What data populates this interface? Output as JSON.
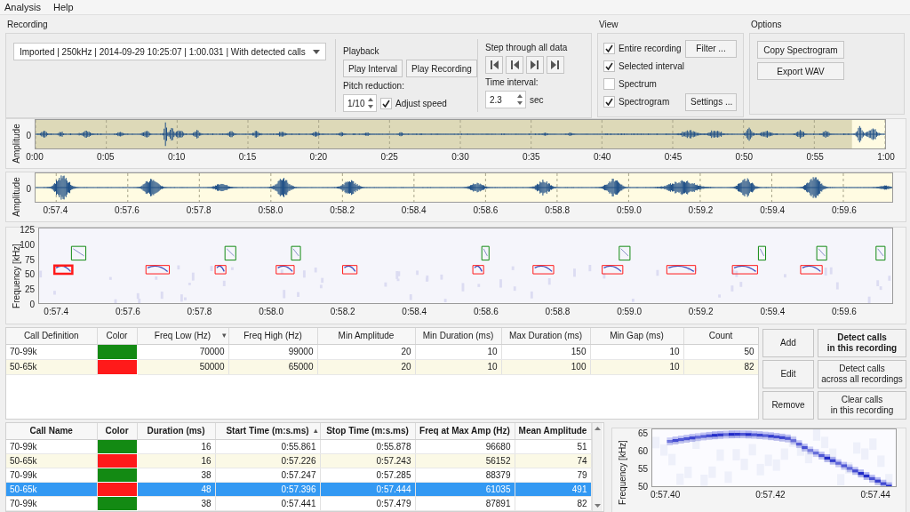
{
  "menu": [
    {
      "label": "Analysis"
    },
    {
      "label": "Help"
    }
  ],
  "recording": {
    "title": "Recording",
    "selector": "Imported | 250kHz | 2014-09-29 10:25:07 | 1:00.031 | With detected calls"
  },
  "playback": {
    "title": "Playback",
    "buttons": [
      "Play Interval",
      "Play Recording"
    ],
    "pitch_label": "Pitch reduction:",
    "pitch_value": "1/10",
    "adjust_speed": {
      "label": "Adjust speed",
      "checked": true
    }
  },
  "step": {
    "title": "Step through all data",
    "interval_label": "Time interval:",
    "interval_value": "2.3",
    "unit": "sec"
  },
  "view": {
    "title": "View",
    "options": [
      {
        "label": "Entire recording",
        "checked": true
      },
      {
        "label": "Selected interval",
        "checked": true
      },
      {
        "label": "Spectrum",
        "checked": false
      },
      {
        "label": "Spectrogram",
        "checked": true
      }
    ],
    "buttons": [
      "Filter ...",
      "Settings ..."
    ]
  },
  "options": {
    "title": "Options",
    "buttons": [
      "Copy Spectrogram",
      "Export WAV"
    ]
  },
  "overview": {
    "ylabel": "Amplitude",
    "ytick": "0",
    "xticks": [
      "0:00",
      "0:05",
      "0:10",
      "0:15",
      "0:20",
      "0:25",
      "0:30",
      "0:35",
      "0:40",
      "0:45",
      "0:50",
      "0:55",
      "1:00"
    ]
  },
  "detail": {
    "ylabel": "Amplitude",
    "ytick": "0",
    "xticks": [
      "0:57.4",
      "0:57.6",
      "0:57.8",
      "0:58.0",
      "0:58.2",
      "0:58.4",
      "0:58.6",
      "0:58.8",
      "0:59.0",
      "0:59.2",
      "0:59.4",
      "0:59.6"
    ]
  },
  "spectrogram": {
    "ylabel": "Frequency [kHz]",
    "yticks": [
      "125",
      "100",
      "75",
      "50",
      "25",
      "0"
    ],
    "xticks": [
      "0:57.4",
      "0:57.6",
      "0:57.8",
      "0:58.0",
      "0:58.2",
      "0:58.4",
      "0:58.6",
      "0:58.8",
      "0:59.0",
      "0:59.2",
      "0:59.4",
      "0:59.6"
    ]
  },
  "definitions": {
    "columns": [
      {
        "label": "Call Definition"
      },
      {
        "label": "Color"
      },
      {
        "label": "Freq Low (Hz)",
        "sort_arrow": "▾"
      },
      {
        "label": "Freq High (Hz)"
      },
      {
        "label": "Min Amplitude"
      },
      {
        "label": "Min Duration (ms)"
      },
      {
        "label": "Max Duration (ms)"
      },
      {
        "label": "Min Gap (ms)"
      },
      {
        "label": "Count"
      }
    ],
    "rows": [
      {
        "color": "#138a13",
        "cells": [
          "70-99k",
          "",
          "70000",
          "99000",
          "20",
          "10",
          "150",
          "10",
          "50"
        ]
      },
      {
        "color": "#ff1a1a",
        "cells": [
          "50-65k",
          "",
          "50000",
          "65000",
          "20",
          "10",
          "100",
          "10",
          "82"
        ]
      }
    ]
  },
  "definition_buttons": [
    "Add",
    "Edit",
    "Remove"
  ],
  "detect_buttons": [
    {
      "label": "Detect calls\nin this recording",
      "bold": true
    },
    {
      "label": "Detect calls\nacross all recordings",
      "bold": false
    },
    {
      "label": "Clear calls\nin this recording",
      "bold": false
    }
  ],
  "calls": {
    "columns": [
      {
        "label": "Call Name"
      },
      {
        "label": "Color"
      },
      {
        "label": "Duration (ms)"
      },
      {
        "label": "Start Time (m:s.ms)",
        "sort_arrow": "▴"
      },
      {
        "label": "Stop Time (m:s.ms)"
      },
      {
        "label": "Freq at Max Amp (Hz)"
      },
      {
        "label": "Mean Amplitude"
      }
    ],
    "rows": [
      {
        "color": "#138a13",
        "selected": false,
        "cells": [
          "70-99k",
          "",
          "16",
          "0:55.861",
          "0:55.878",
          "96680",
          "51"
        ]
      },
      {
        "color": "#ff1a1a",
        "selected": false,
        "cells": [
          "50-65k",
          "",
          "16",
          "0:57.226",
          "0:57.243",
          "56152",
          "74"
        ]
      },
      {
        "color": "#138a13",
        "selected": false,
        "cells": [
          "70-99k",
          "",
          "38",
          "0:57.247",
          "0:57.285",
          "88379",
          "79"
        ]
      },
      {
        "color": "#ff1a1a",
        "selected": true,
        "cells": [
          "50-65k",
          "",
          "48",
          "0:57.396",
          "0:57.444",
          "61035",
          "491"
        ]
      },
      {
        "color": "#138a13",
        "selected": false,
        "cells": [
          "70-99k",
          "",
          "38",
          "0:57.441",
          "0:57.479",
          "87891",
          "82"
        ]
      }
    ]
  },
  "call_spectrogram": {
    "ylabel": "Frequency [kHz]",
    "yticks": [
      "65",
      "60",
      "55",
      "50"
    ],
    "xticks": [
      "0:57.40",
      "0:57.42",
      "0:57.44"
    ]
  }
}
